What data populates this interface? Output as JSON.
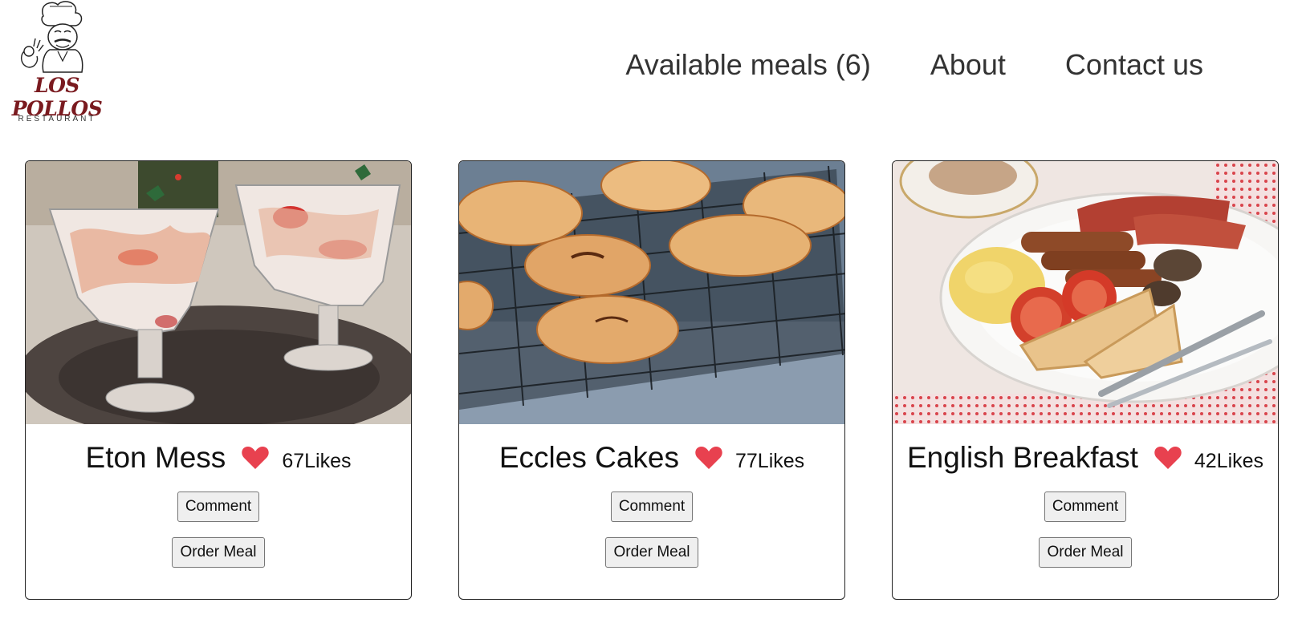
{
  "brand": {
    "name": "LOS POLLOS",
    "subtitle": "RESTAURANT",
    "logo_icon": "chef-icon"
  },
  "nav": {
    "items": [
      {
        "label": "Available meals (6)"
      },
      {
        "label": "About"
      },
      {
        "label": "Contact us"
      }
    ]
  },
  "meals": [
    {
      "name": "Eton Mess",
      "likes": "67Likes",
      "comment_label": "Comment",
      "order_label": "Order Meal",
      "image_icon": "eton-mess-photo"
    },
    {
      "name": "Eccles Cakes",
      "likes": "77Likes",
      "comment_label": "Comment",
      "order_label": "Order Meal",
      "image_icon": "eccles-cakes-photo"
    },
    {
      "name": "English Breakfast",
      "likes": "42Likes",
      "comment_label": "Comment",
      "order_label": "Order Meal",
      "image_icon": "english-breakfast-photo"
    }
  ],
  "colors": {
    "heart": "#e8414f",
    "logo_text": "#7a1a1f",
    "nav_text": "#333333"
  }
}
